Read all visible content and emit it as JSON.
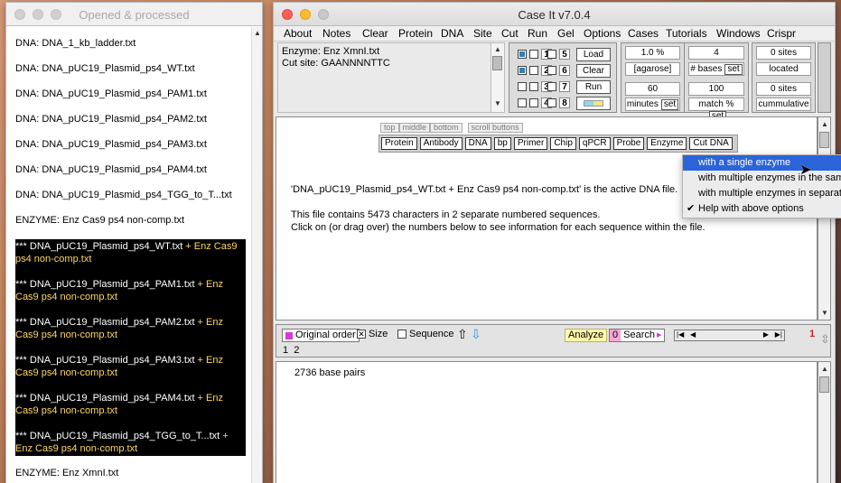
{
  "left_window": {
    "title": "Opened & processed",
    "items": [
      "DNA: DNA_1_kb_ladder.txt",
      "DNA: DNA_pUC19_Plasmid_ps4_WT.txt",
      "DNA: DNA_pUC19_Plasmid_ps4_PAM1.txt",
      "DNA: DNA_pUC19_Plasmid_ps4_PAM2.txt",
      "DNA: DNA_pUC19_Plasmid_ps4_PAM3.txt",
      "DNA: DNA_pUC19_Plasmid_ps4_PAM4.txt",
      "DNA: DNA_pUC19_Plasmid_ps4_TGG_to_T...txt",
      "ENZYME: Enz Cas9 ps4 non-comp.txt"
    ],
    "selected": [
      {
        "dna": "*** DNA_pUC19_Plasmid_ps4_WT.txt",
        "enz": " + Enz Cas9 ps4 non-comp.txt"
      },
      {
        "dna": "*** DNA_pUC19_Plasmid_ps4_PAM1.txt",
        "enz": " + Enz Cas9 ps4 non-comp.txt"
      },
      {
        "dna": "*** DNA_pUC19_Plasmid_ps4_PAM2.txt",
        "enz": " + Enz Cas9 ps4 non-comp.txt"
      },
      {
        "dna": "*** DNA_pUC19_Plasmid_ps4_PAM3.txt",
        "enz": " + Enz Cas9 ps4 non-comp.txt"
      },
      {
        "dna": "*** DNA_pUC19_Plasmid_ps4_PAM4.txt",
        "enz": " + Enz Cas9 ps4 non-comp.txt"
      },
      {
        "dna": "*** DNA_pUC19_Plasmid_ps4_TGG_to_T...txt",
        "enz": " + Enz Cas9 ps4 non-comp.txt"
      }
    ],
    "last_item": "ENZYME: Enz XmnI.txt"
  },
  "main_window": {
    "title": "Case It v7.0.4",
    "menu": [
      "About",
      "Notes",
      "Clear",
      "Protein",
      "DNA",
      "Site",
      "Cut",
      "Run",
      "Gel",
      "Options",
      "Cases",
      "Tutorials",
      "Windows",
      "Crispr"
    ],
    "enzyme_line": "Enzyme: Enz XmnI.txt",
    "cut_site_line": "Cut site: GAANNNNTTC",
    "lanes": [
      "1",
      "2",
      "3",
      "4",
      "5",
      "6",
      "7",
      "8"
    ],
    "lane_checked": [
      true,
      true,
      false,
      false,
      false,
      false,
      false,
      false
    ],
    "ctrl_buttons": [
      "Load",
      "Clear",
      "Run"
    ],
    "agarose_value": "1.0 %",
    "agarose_label": "[agarose]",
    "minutes_value": "60",
    "minutes_label": "minutes",
    "set_label": "set",
    "bases_value": "4",
    "bases_label": "# bases",
    "match_value": "100",
    "match_label": "match %",
    "sites_value_1": "0 sites",
    "located_label": "located",
    "sites_value_2": "0 sites",
    "cumulative_label": "cummulative",
    "scroll_tabs": [
      "top",
      "middle",
      "bottom",
      "scroll buttons"
    ],
    "scroll_buttons": [
      "Protein",
      "Antibody",
      "DNA",
      "bp",
      "Primer",
      "Chip",
      "qPCR",
      "Probe",
      "Enzyme",
      "Cut DNA"
    ],
    "active_dna_text": "'DNA_pUC19_Plasmid_ps4_WT.txt + Enz Cas9 ps4 non-comp.txt' is the active DNA file.",
    "info_line_1": "This file contains 5473 characters in 2 separate numbered sequences.",
    "info_line_2": "Click on (or drag over) the numbers below to see information for each sequence within the file.",
    "dropdown": {
      "items": [
        "with a single enzyme",
        "with multiple enzymes in the same",
        "with multiple enzymes in separate",
        "Help with above options"
      ],
      "active_index": 0,
      "checked_index": 3
    },
    "toolbar": {
      "original_order": "Original order",
      "size_label": "Size",
      "sequence_label": "Sequence",
      "analyze_label": "Analyze",
      "search_count": "0",
      "search_label": "Search",
      "red_number": "1",
      "sequence_numbers": "1  2"
    },
    "bottom_text": "2736 base pairs"
  },
  "colors": {
    "selected_bg": "#000000",
    "selected_enzyme_text": "#ffd75e",
    "dropdown_active": "#2a64d8",
    "analyze_bg": "#fff9a8",
    "search_badge": "#f4a6d8"
  }
}
